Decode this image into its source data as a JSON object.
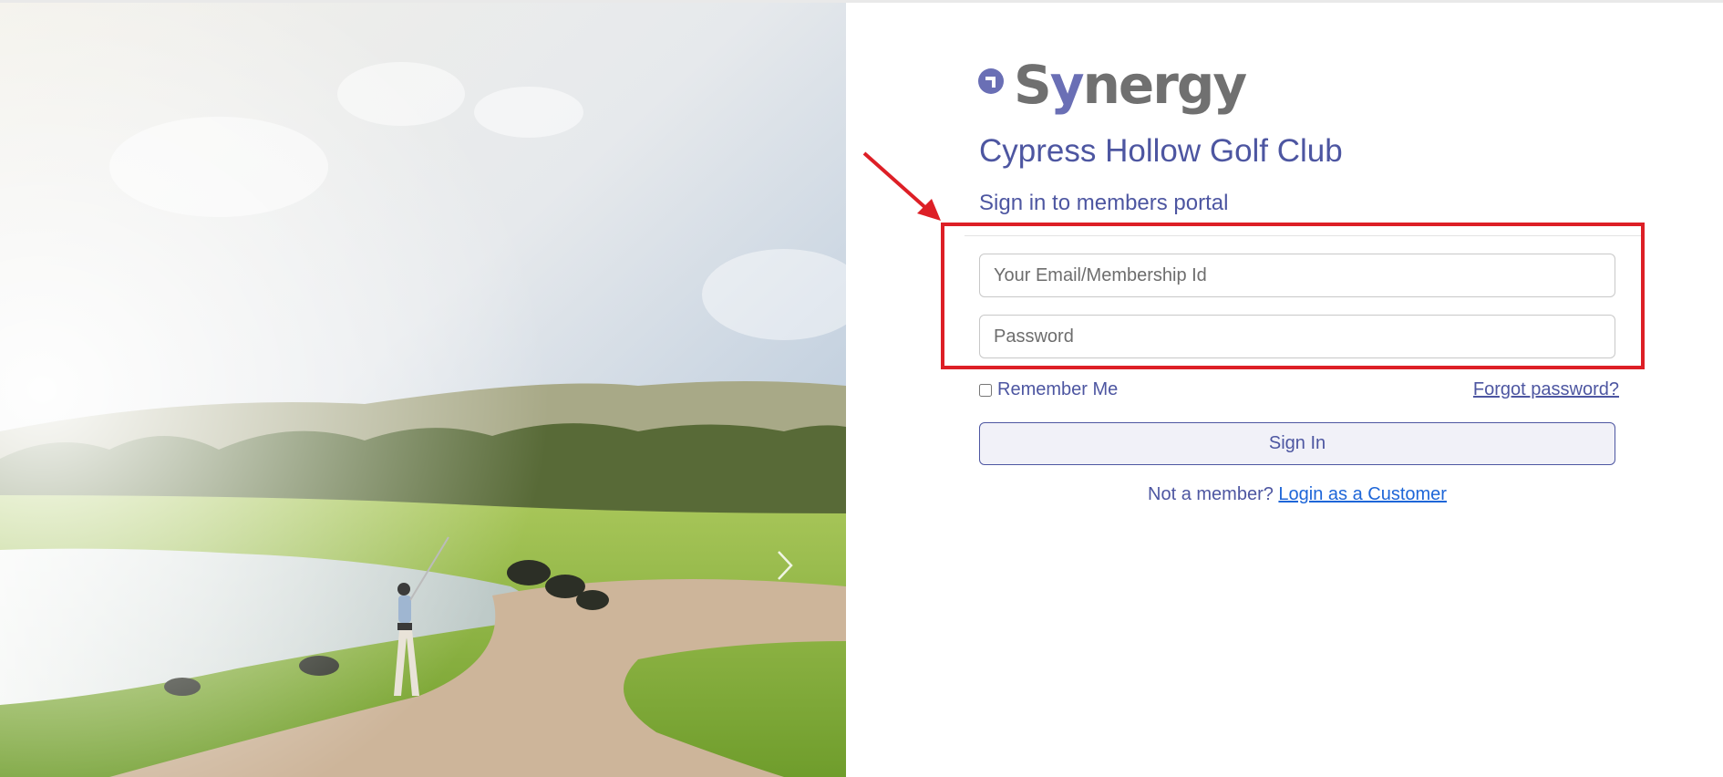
{
  "brand": {
    "logo_text_pre": "S",
    "logo_text_accent": "y",
    "logo_text_post": "nergy",
    "accent_color": "#4d56a1",
    "logo_accent_color": "#6a6fb5"
  },
  "club": {
    "name": "Cypress Hollow Golf Club",
    "subtitle": "Sign in to members portal"
  },
  "form": {
    "email_placeholder": "Your Email/Membership Id",
    "email_value": "",
    "password_placeholder": "Password",
    "password_value": "",
    "remember_label": "Remember Me",
    "remember_checked": false,
    "forgot_label": "Forgot password?",
    "signin_label": "Sign In"
  },
  "footer": {
    "not_member_text": "Not a member?",
    "customer_link": "Login as a Customer",
    "link_color": "#1e66d8"
  },
  "annotation": {
    "highlight_color": "#dd1f26"
  },
  "icons": {
    "carousel_next": "chevron-right-icon",
    "logo_mark": "synergy-logo-mark-icon"
  }
}
